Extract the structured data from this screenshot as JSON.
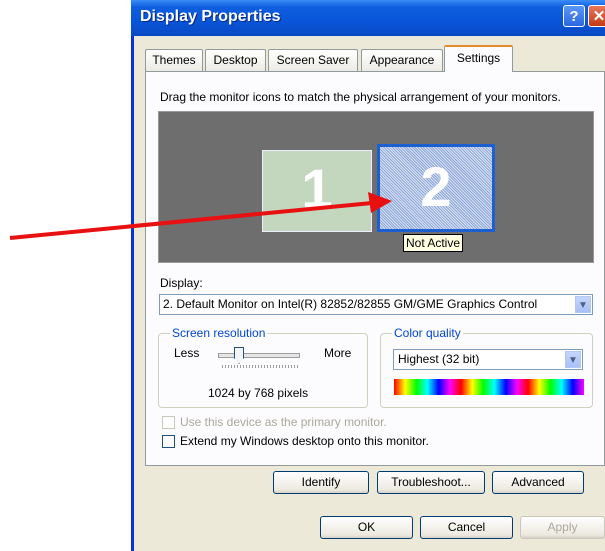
{
  "window": {
    "title": "Display Properties",
    "help_glyph": "?",
    "close_glyph": "✕"
  },
  "tabs": [
    {
      "label": "Themes",
      "selected": false
    },
    {
      "label": "Desktop",
      "selected": false
    },
    {
      "label": "Screen Saver",
      "selected": false
    },
    {
      "label": "Appearance",
      "selected": false
    },
    {
      "label": "Settings",
      "selected": true
    }
  ],
  "settings": {
    "hint": "Drag the monitor icons to match the physical arrangement of your monitors.",
    "monitors": [
      {
        "number": "1"
      },
      {
        "number": "2"
      }
    ],
    "tooltip": "Not Active",
    "display_label": "Display:",
    "display_value": "2. Default Monitor on Intel(R) 82852/82855 GM/GME Graphics Control",
    "resolution": {
      "legend": "Screen resolution",
      "less": "Less",
      "more": "More",
      "value_text": "1024 by 768 pixels"
    },
    "color_quality": {
      "legend": "Color quality",
      "value": "Highest (32 bit)"
    },
    "primary_checkbox": {
      "label": "Use this device as the primary monitor.",
      "checked": false,
      "enabled": false
    },
    "extend_checkbox": {
      "label": "Extend my Windows desktop onto this monitor.",
      "checked": false,
      "enabled": true
    },
    "buttons": {
      "identify": "Identify",
      "troubleshoot": "Troubleshoot...",
      "advanced": "Advanced"
    }
  },
  "dialog_buttons": {
    "ok": "OK",
    "cancel": "Cancel",
    "apply": "Apply"
  },
  "colors": {
    "title_bar": "#0854d8",
    "dialog_bg": "#ece9d8",
    "arrow": "#e81010",
    "monitor_area": "#6e6e6e"
  }
}
